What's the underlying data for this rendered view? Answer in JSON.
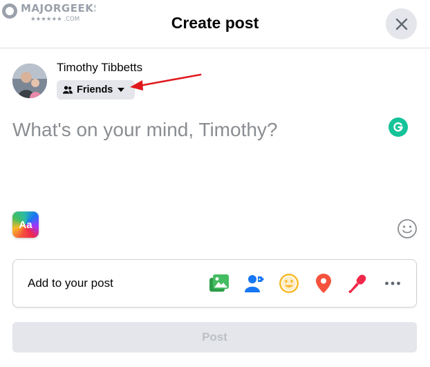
{
  "watermark": {
    "line1": "MAJORGEEKS",
    "line2": "★★★★★★ .COM"
  },
  "header": {
    "title": "Create post",
    "close_icon": "close-icon"
  },
  "user": {
    "name": "Timothy Tibbetts",
    "audience": "Friends",
    "audience_icon": "friends-icon"
  },
  "composer": {
    "placeholder": "What's on your mind, Timothy?"
  },
  "toolbar": {
    "background_picker_label": "Aa"
  },
  "add_to_post": {
    "label": "Add to your post",
    "icons": [
      "photo-video-icon",
      "tag-people-icon",
      "feeling-icon",
      "check-in-icon",
      "live-video-icon",
      "more-icon"
    ]
  },
  "post_button": {
    "label": "Post"
  },
  "colors": {
    "primary": "#1877f2",
    "photo": "#45bd62",
    "feeling": "#f7b928",
    "checkin": "#f5533d",
    "live": "#f02849",
    "grammarly": "#15c39a",
    "annotation_arrow": "#e0191d",
    "disabled_button": "#e4e6eb"
  }
}
